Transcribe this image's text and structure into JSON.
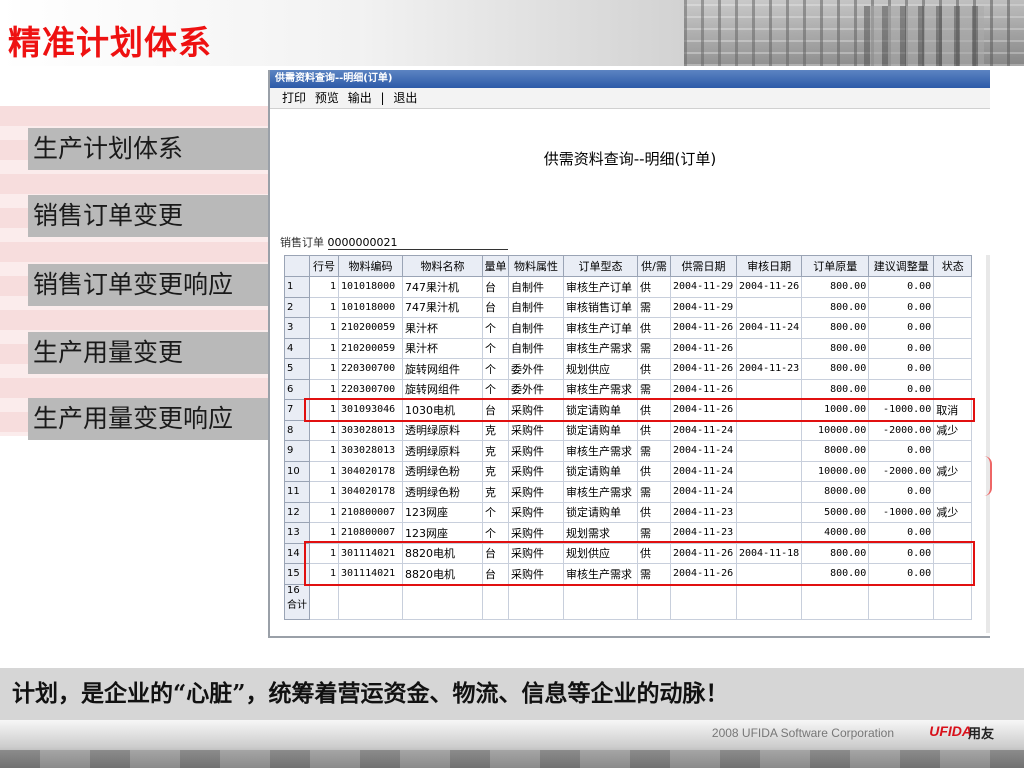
{
  "slide_title": "精准计划体系",
  "menu": [
    "生产计划体系",
    "销售订单变更",
    "销售订单变更响应",
    "生产用量变更",
    "生产用量变更响应"
  ],
  "window": {
    "title": "供需资料查询--明细(订单)",
    "toolbar": [
      "打印",
      "预览",
      "输出",
      "|",
      "退出"
    ],
    "report_title": "供需资料查询--明细(订单)",
    "order_label": "销售订单",
    "order_value": "0000000021"
  },
  "table": {
    "columns": [
      "",
      "行号",
      "物料编码",
      "物料名称",
      "量单",
      "物料属性",
      "订单型态",
      "供/需",
      "供需日期",
      "审核日期",
      "订单原量",
      "建议调整量",
      "状态"
    ],
    "rows": [
      [
        "1",
        "1",
        "101018000",
        "747果汁机",
        "台",
        "自制件",
        "审核生产订单",
        "供",
        "2004-11-29",
        "2004-11-26",
        "800.00",
        "0.00",
        ""
      ],
      [
        "2",
        "1",
        "101018000",
        "747果汁机",
        "台",
        "自制件",
        "审核销售订单",
        "需",
        "2004-11-29",
        "",
        "800.00",
        "0.00",
        ""
      ],
      [
        "3",
        "1",
        "210200059",
        "果汁杯",
        "个",
        "自制件",
        "审核生产订单",
        "供",
        "2004-11-26",
        "2004-11-24",
        "800.00",
        "0.00",
        ""
      ],
      [
        "4",
        "1",
        "210200059",
        "果汁杯",
        "个",
        "自制件",
        "审核生产需求",
        "需",
        "2004-11-26",
        "",
        "800.00",
        "0.00",
        ""
      ],
      [
        "5",
        "1",
        "220300700",
        "旋转网组件",
        "个",
        "委外件",
        "规划供应",
        "供",
        "2004-11-26",
        "2004-11-23",
        "800.00",
        "0.00",
        ""
      ],
      [
        "6",
        "1",
        "220300700",
        "旋转网组件",
        "个",
        "委外件",
        "审核生产需求",
        "需",
        "2004-11-26",
        "",
        "800.00",
        "0.00",
        ""
      ],
      [
        "7",
        "1",
        "301093046",
        "1030电机",
        "台",
        "采购件",
        "锁定请购单",
        "供",
        "2004-11-26",
        "",
        "1000.00",
        "-1000.00",
        "取消"
      ],
      [
        "8",
        "1",
        "303028013",
        "透明绿原料",
        "克",
        "采购件",
        "锁定请购单",
        "供",
        "2004-11-24",
        "",
        "10000.00",
        "-2000.00",
        "减少"
      ],
      [
        "9",
        "1",
        "303028013",
        "透明绿原料",
        "克",
        "采购件",
        "审核生产需求",
        "需",
        "2004-11-24",
        "",
        "8000.00",
        "0.00",
        ""
      ],
      [
        "10",
        "1",
        "304020178",
        "透明绿色粉",
        "克",
        "采购件",
        "锁定请购单",
        "供",
        "2004-11-24",
        "",
        "10000.00",
        "-2000.00",
        "减少"
      ],
      [
        "11",
        "1",
        "304020178",
        "透明绿色粉",
        "克",
        "采购件",
        "审核生产需求",
        "需",
        "2004-11-24",
        "",
        "8000.00",
        "0.00",
        ""
      ],
      [
        "12",
        "1",
        "210800007",
        "123网座",
        "个",
        "采购件",
        "锁定请购单",
        "供",
        "2004-11-23",
        "",
        "5000.00",
        "-1000.00",
        "减少"
      ],
      [
        "13",
        "1",
        "210800007",
        "123网座",
        "个",
        "采购件",
        "规划需求",
        "需",
        "2004-11-23",
        "",
        "4000.00",
        "0.00",
        ""
      ],
      [
        "14",
        "1",
        "301114021",
        "8820电机",
        "台",
        "采购件",
        "规划供应",
        "供",
        "2004-11-26",
        "2004-11-18",
        "800.00",
        "0.00",
        ""
      ],
      [
        "15",
        "1",
        "301114021",
        "8820电机",
        "台",
        "采购件",
        "审核生产需求",
        "需",
        "2004-11-26",
        "",
        "800.00",
        "0.00",
        ""
      ]
    ],
    "total_row_label_1": "16",
    "total_row_label_2": "合计"
  },
  "quote": "计划，是企业的“心脏”，统筹着营运资金、物流、信息等企业的动脉！",
  "footer": {
    "copyright": "2008 UFIDA Software Corporation",
    "logo": "UFIDA",
    "logo_cn": "用友"
  },
  "colors": {
    "title": "#ee1111",
    "highlight": "#e11010",
    "menu_bg": "#b9b9b9"
  }
}
